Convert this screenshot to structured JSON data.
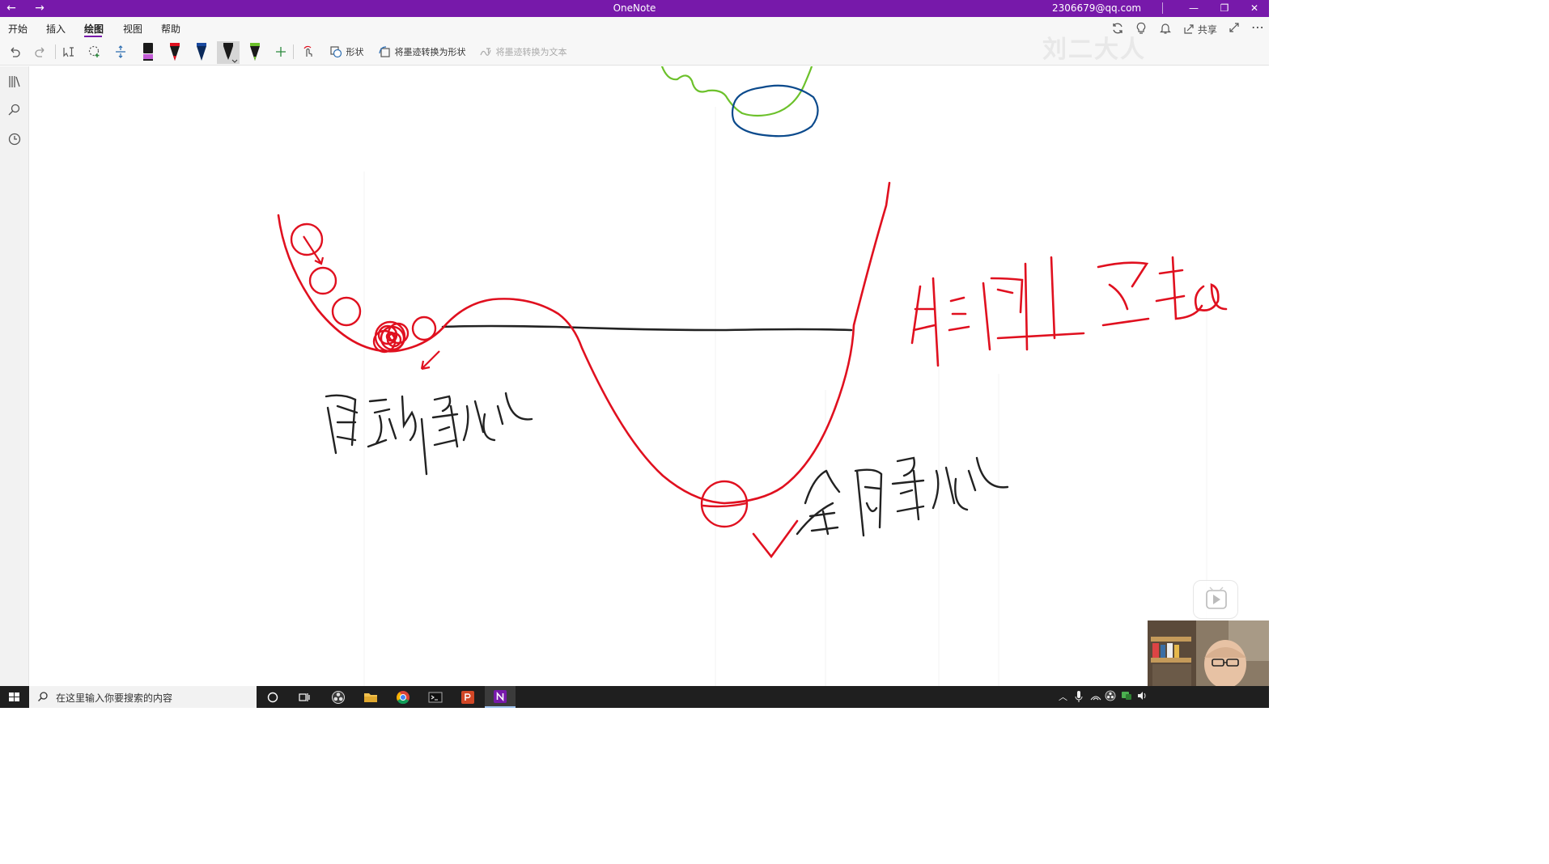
{
  "titlebar": {
    "title": "OneNote",
    "account": "2306679@qq.com",
    "back_icon": "←",
    "forward_icon": "→",
    "minimize": "—",
    "restore": "❐",
    "close": "✕"
  },
  "ribbon": {
    "tabs": [
      {
        "label": "开始"
      },
      {
        "label": "插入"
      },
      {
        "label": "绘图"
      },
      {
        "label": "视图"
      },
      {
        "label": "帮助"
      }
    ],
    "active_tab": "绘图",
    "share_label": "共享"
  },
  "toolbar": {
    "shapes_label": "形状",
    "ink_to_shape_label": "将墨迹转换为形状",
    "ink_to_text_label": "将墨迹转换为文本",
    "pens": [
      {
        "name": "pen-black-purple",
        "color": "#1a1a1a",
        "accent": "#c25bd6"
      },
      {
        "name": "pen-red",
        "color": "#e0101f",
        "accent": "#e0101f"
      },
      {
        "name": "pen-navy",
        "color": "#0b2a5b",
        "accent": "#1a4aa0"
      },
      {
        "name": "pen-black",
        "color": "#1a1a1a",
        "accent": "#1a1a1a",
        "selected": true
      },
      {
        "name": "pen-green",
        "color": "#1a1a1a",
        "accent": "#6cc12b"
      }
    ]
  },
  "watermark": "刘二大人",
  "taskbar": {
    "search_placeholder": "在这里输入你要搜索的内容"
  },
  "colors": {
    "title_purple": "#7719aa",
    "ink_red": "#e0101f",
    "ink_black": "#222222",
    "ink_green": "#6cc12b",
    "ink_blue": "#0b4a8c"
  }
}
